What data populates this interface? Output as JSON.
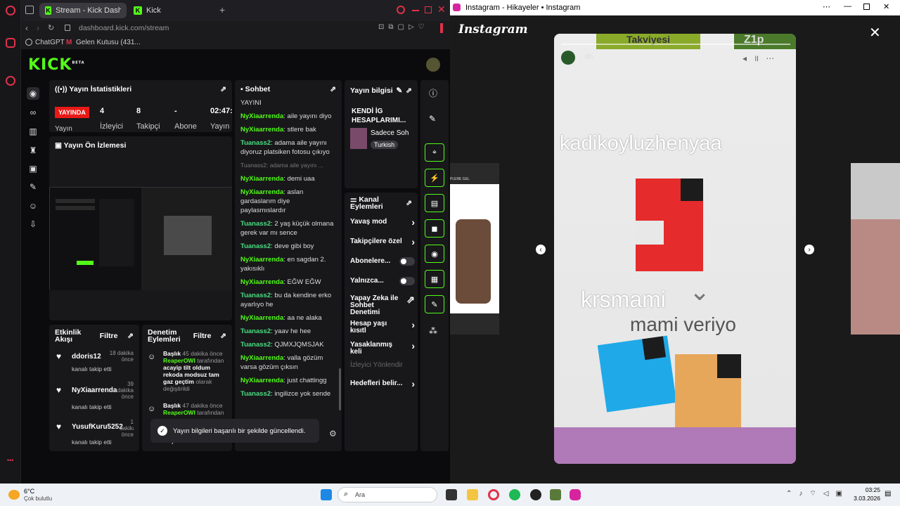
{
  "left_browser": {
    "tabs": [
      {
        "label": "Stream - Kick Dashboard"
      },
      {
        "label": "Kick"
      }
    ],
    "new_tab": "+",
    "url": "dashboard.kick.com/stream",
    "url_domain": "dashboard.kick.com",
    "bookmarks": [
      {
        "label": "ChatGPT"
      },
      {
        "label": "Gelen Kutusu (431..."
      }
    ]
  },
  "kick": {
    "logo": "KICK",
    "logo_beta": "BETA",
    "stats": {
      "title": "Yayın İstatistikleri",
      "live_badge": "YAYINDA",
      "live_label": "Yayın",
      "items": [
        {
          "value": "4",
          "label": "İzleyici"
        },
        {
          "value": "8",
          "label": "Takipçi"
        },
        {
          "value": "-",
          "label": "Abone"
        },
        {
          "value": "02:47:3",
          "label": "Yayın"
        }
      ]
    },
    "preview": {
      "title": "Yayın Ön İzlemesi"
    },
    "chat": {
      "title": "Sohbet",
      "top_cut": "YAYINI",
      "messages": [
        {
          "user": "NyXiaarrenda",
          "text": "aile yayını diyo",
          "color": "#53fc18"
        },
        {
          "user": "NyXiaarrenda",
          "text": "stlere bak",
          "color": "#53fc18"
        },
        {
          "user": "Tuanass2",
          "text": "adama aile yayını diyoruz platsiken fotosu çıkıyo",
          "color": "#53fc18"
        },
        {
          "reply": "Tuanass2: adama aile yayını ..."
        },
        {
          "user": "NyXiaarrenda",
          "text": "demi uaa",
          "color": "#53fc18"
        },
        {
          "user": "NyXiaarrenda",
          "text": "aslan gardaslarım diye paylasmıslardır",
          "color": "#53fc18"
        },
        {
          "user": "Tuanass2",
          "text": "2 yaş küçük olmana gerek var mı sence",
          "color": "#53fc18"
        },
        {
          "user": "Tuanass2",
          "text": "deve gibi boy",
          "color": "#53fc18"
        },
        {
          "user": "NyXiaarrenda",
          "text": "en sagdan 2. yakısıklı",
          "color": "#53fc18"
        },
        {
          "user": "NyXiaarrenda",
          "text": "EĞW EĞW",
          "color": "#53fc18"
        },
        {
          "user": "Tuanass2",
          "text": "bu da kendine erko ayarlıyo he",
          "color": "#53fc18"
        },
        {
          "user": "NyXiaarrenda",
          "text": "aa ne alaka",
          "color": "#53fc18"
        },
        {
          "user": "Tuanass2",
          "text": "yaav he hee",
          "color": "#53fc18"
        },
        {
          "user": "Tuanass2",
          "text": "QJMXJQMSJAK",
          "color": "#53fc18"
        },
        {
          "user": "NyXiaarrenda",
          "text": "valla gözüm varsa gözüm çıksın",
          "color": "#53fc18"
        },
        {
          "user": "NyXiaarrenda",
          "text": "just chattingg",
          "color": "#53fc18"
        },
        {
          "user": "Tuanass2",
          "text": "ingilizce yok sende",
          "color": "#53fc18"
        }
      ]
    },
    "stream_info": {
      "title": "Yayın bilgisi",
      "stream_title": "KENDİ İG HESAPLARIMI...",
      "category": "Sadece Soh",
      "tag": "Turkish"
    },
    "channel_actions": {
      "title": "Kanal Eylemleri",
      "items": [
        {
          "label": "Yavaş mod",
          "control": "arrow"
        },
        {
          "label": "Takipçilere özel",
          "control": "arrow"
        },
        {
          "label": "Abonelere...",
          "control": "toggle"
        },
        {
          "label": "Yalnızca...",
          "control": "toggle"
        },
        {
          "label": "Yapay Zeka ile Sohbet Denetimi",
          "control": "link"
        },
        {
          "label": "Hesap yaşı kısıtl",
          "control": "arrow"
        },
        {
          "label": "Yasaklanmış keli",
          "control": "arrow"
        },
        {
          "label": "İzleyici Yönlendir",
          "control": "none"
        },
        {
          "label": "Hedefleri belir...",
          "control": "arrow"
        }
      ]
    },
    "activity": {
      "title": "Etkinlik Akışı",
      "filter": "Filtre",
      "items": [
        {
          "user": "ddoris12",
          "action": "kanalı takip etti",
          "time": "18 dakika önce"
        },
        {
          "user": "NyXiaarrenda",
          "action": "kanalı takip etti",
          "time": "39 dakika önce"
        },
        {
          "user": "YusufKuru5252",
          "action": "kanalı takip etti",
          "time": "1 dakika önce"
        }
      ]
    },
    "moderation": {
      "title": "Denetim Eylemleri",
      "filter": "Filtre",
      "items": [
        {
          "kind": "Başlık",
          "time": "45 dakika önce",
          "by": "ReaperOWI",
          "by_suffix": "tarafından",
          "text": "acayip tilt oldum rekoda modsuz tam gaz geçtim",
          "tail": "olarak değiştirildi"
        },
        {
          "kind": "Başlık",
          "time": "47 dakika önce",
          "by": "ReaperOWI",
          "by_suffix": "tarafından",
          "text": "",
          "tail": ""
        },
        {
          "kind": "Başlık",
          "time": "1 saat önce",
          "by": "",
          "by_suffix": "",
          "text": "",
          "tail": ""
        }
      ]
    },
    "toast": "Yayın bilgileri başarılı bir şekilde güncellendi."
  },
  "right_window": {
    "title": "Instagram - Hikayeler • Instagram",
    "logo": "Instagram",
    "story": {
      "time": "8h",
      "top_banner": "Takviyesi",
      "top_banner_right": "Z1p",
      "text1": "kadikoyluzhenyaa",
      "text2": "krsmami",
      "text3": "mami veriyo"
    },
    "side_thumb_label": "PLERE GEL"
  },
  "taskbar": {
    "weather_temp": "6°C",
    "weather_desc": "Çok bulutlu",
    "search_placeholder": "Ara",
    "time": "03:25",
    "date": "3.03.2026"
  }
}
